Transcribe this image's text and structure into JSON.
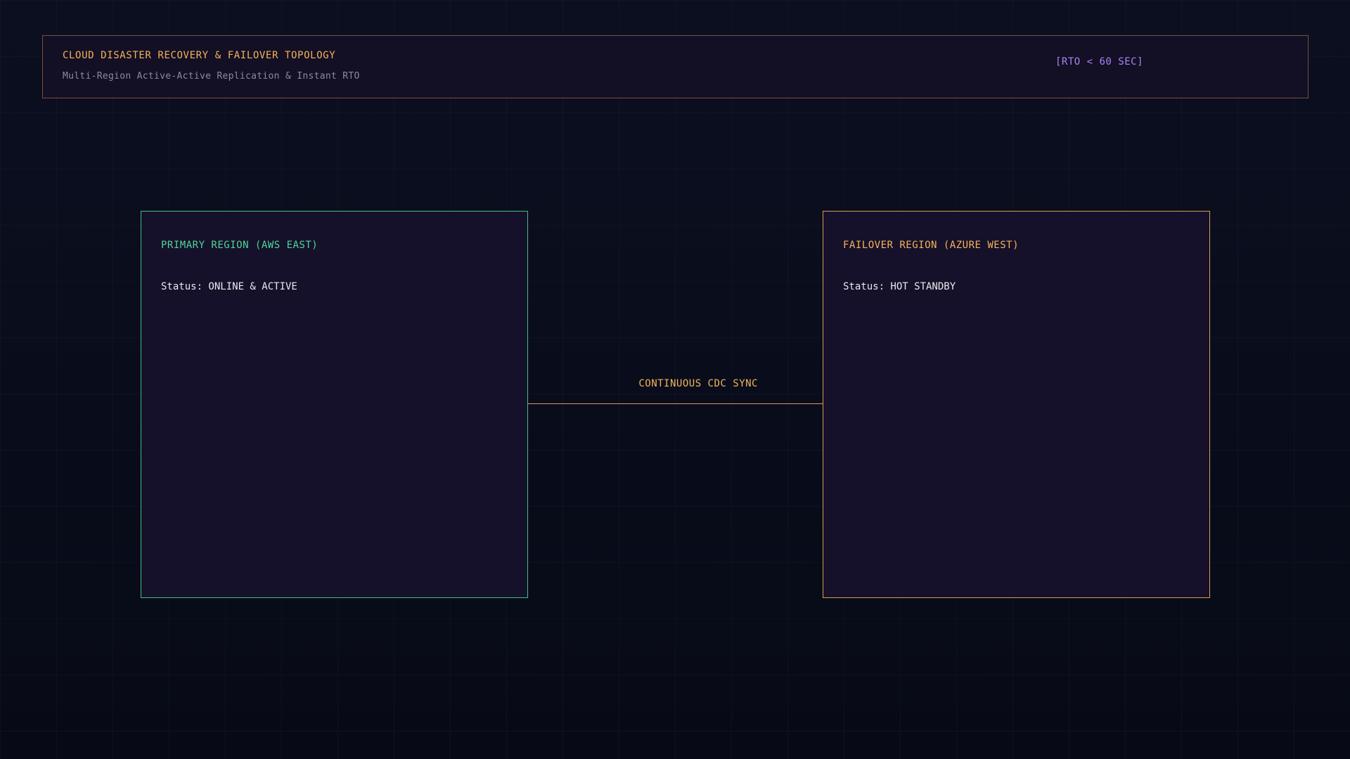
{
  "header": {
    "title": "CLOUD DISASTER RECOVERY & FAILOVER TOPOLOGY",
    "subtitle": "Multi-Region Active-Active Replication & Instant RTO",
    "badge": "[RTO < 60 SEC]"
  },
  "regions": [
    {
      "title": "PRIMARY REGION (AWS EAST)",
      "status": "Status: ONLINE & ACTIVE",
      "accent": "#3fbf86"
    },
    {
      "title": "FAILOVER REGION (AZURE WEST)",
      "status": "Status: HOT STANDBY",
      "accent": "#d99a4e"
    }
  ],
  "connection": {
    "label": "CONTINUOUS CDC SYNC",
    "color": "#d99a4e"
  }
}
